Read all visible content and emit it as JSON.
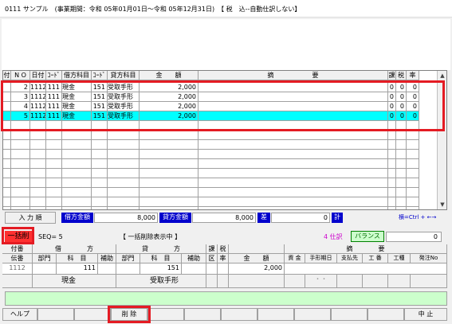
{
  "window": {
    "title": "0111 サンプル　(事業期間：令和 05年01月01日～令和 05年12月31日)　【 税　込--自動仕訳しない】"
  },
  "grid": {
    "headers": [
      "付",
      "N O",
      "日付",
      "ｺｰﾄﾞ",
      "借方科目",
      "ｺｰﾄﾞ",
      "貸方科目",
      "金　　額",
      "摘　　　　　　要",
      "課",
      "税",
      "率"
    ],
    "rows": [
      {
        "no": "2",
        "date": "1112",
        "dcode": "111",
        "debit": "現金",
        "ccode": "151",
        "credit": "受取手形",
        "amount": "2,000",
        "k": "0",
        "z": "0",
        "r": "0",
        "hl": false
      },
      {
        "no": "3",
        "date": "1112",
        "dcode": "111",
        "debit": "現金",
        "ccode": "151",
        "credit": "受取手形",
        "amount": "2,000",
        "k": "0",
        "z": "0",
        "r": "0",
        "hl": false
      },
      {
        "no": "4",
        "date": "1112",
        "dcode": "111",
        "debit": "現金",
        "ccode": "151",
        "credit": "受取手形",
        "amount": "2,000",
        "k": "0",
        "z": "0",
        "r": "0",
        "hl": false
      },
      {
        "no": "5",
        "date": "1112",
        "dcode": "111",
        "debit": "現金",
        "ccode": "151",
        "credit": "受取手形",
        "amount": "2,000",
        "k": "0",
        "z": "0",
        "r": "0",
        "hl": true
      }
    ]
  },
  "totals": {
    "input_order": "入 力 順",
    "debit_total_label": "借方金額",
    "debit_total": "8,000",
    "credit_total_label": "貸方金額",
    "credit_total": "8,000",
    "diff_label": "差",
    "diff": "0",
    "calc_label": "計",
    "shortcut_hint": "横=Ctrl + ←→"
  },
  "status": {
    "mode": "一括削",
    "seq": "SEQ= 5",
    "message": "【 一括削除表示中 】",
    "entries": "4 仕訳",
    "balance_label": "バランス",
    "balance_value": "0"
  },
  "entry": {
    "h_fuban": "付番",
    "h_debit": "借　　　　方",
    "h_credit": "貸　　　　方",
    "h_ka": "課",
    "h_zei": "税",
    "h_desc": "摘　　　　要",
    "denban": "伝番",
    "dept": "部門",
    "account": "科　目",
    "sub": "補助",
    "dept2": "部門",
    "account2": "科　目",
    "sub2": "補助",
    "kubun": "区",
    "rate": "率",
    "amount_h": "金　　額",
    "s_shikin": "資 金",
    "s_date": "手形期日",
    "s_payee": "支払先",
    "s_koban": "工 番",
    "s_koshu": "工種",
    "s_hatchu": "発注No",
    "denban_val": "1112",
    "debit_code": "111",
    "credit_code": "151",
    "amount": "2,000",
    "debit_name": "現金",
    "credit_name": "受取手形",
    "dots": "・・"
  },
  "fkeys": {
    "help": "ヘルプ",
    "delete": "削 除",
    "stop": "中 止"
  },
  "colors": {
    "highlight": "#00ffff",
    "red": "#e41b23",
    "blue": "#0000cc",
    "green_bar": "#ccffcc",
    "purple": "#cc00cc"
  }
}
